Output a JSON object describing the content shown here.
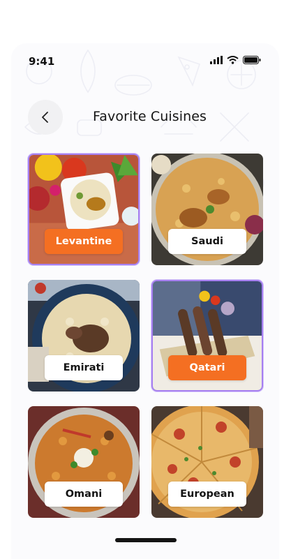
{
  "status_bar": {
    "time": "9:41"
  },
  "header": {
    "title": "Favorite Cuisines"
  },
  "cuisines": [
    {
      "label": "Levantine",
      "selected": true
    },
    {
      "label": "Saudi",
      "selected": false
    },
    {
      "label": "Emirati",
      "selected": false
    },
    {
      "label": "Qatari",
      "selected": true
    },
    {
      "label": "Omani",
      "selected": false
    },
    {
      "label": "European",
      "selected": false
    }
  ],
  "colors": {
    "accent": "#f46f22",
    "selection_border": "#a67ff0"
  }
}
